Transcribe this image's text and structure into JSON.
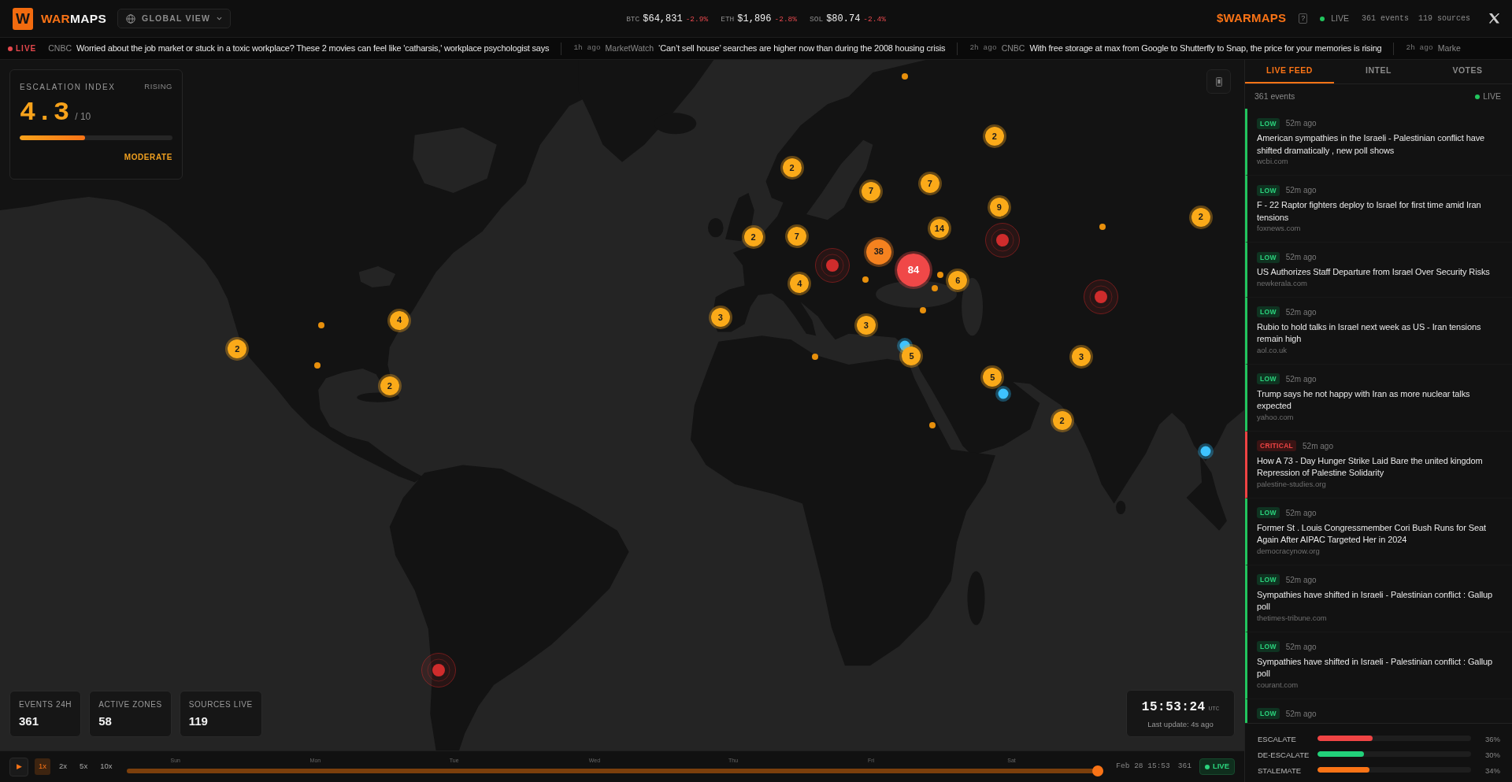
{
  "header": {
    "logo_letter": "W",
    "brand_accent": "WAR",
    "brand_rest": "MAPS",
    "view": "GLOBAL VIEW",
    "prices": [
      {
        "symbol": "BTC",
        "price": "$64,831",
        "change": "-2.9%"
      },
      {
        "symbol": "ETH",
        "price": "$1,896",
        "change": "-2.8%"
      },
      {
        "symbol": "SOL",
        "price": "$80.74",
        "change": "-2.4%"
      }
    ],
    "token": "$WARMAPS",
    "help": "?",
    "status": "LIVE",
    "events": "361 events",
    "sources": "119 sources"
  },
  "ticker": {
    "label": "LIVE",
    "items": [
      {
        "source": "CNBC",
        "headline": "Worried about the job market or stuck in a toxic workplace? These 2 movies can feel like 'catharsis,' workplace psychologist says"
      },
      {
        "time": "1h ago",
        "source": "MarketWatch",
        "headline": "‘Can’t sell house’ searches are higher now than during the 2008 housing crisis"
      },
      {
        "time": "2h ago",
        "source": "CNBC",
        "headline": "With free storage at max from Google to Shutterfly to Snap, the price for your memories is rising"
      },
      {
        "time": "2h ago",
        "source": "Marke"
      }
    ]
  },
  "escalation": {
    "title": "ESCALATION INDEX",
    "trend": "RISING",
    "score": "4.3",
    "scale": "/ 10",
    "level": 0.43,
    "rating": "MODERATE"
  },
  "map": {
    "markers": [
      {
        "kind": "event"
      },
      {
        "kind": "cluster",
        "count": "2"
      },
      {
        "kind": "cluster",
        "count": "2"
      },
      {
        "kind": "cluster",
        "count": "7"
      },
      {
        "kind": "cluster",
        "count": "7"
      },
      {
        "kind": "cluster",
        "count": "9"
      },
      {
        "kind": "cluster",
        "count": "2"
      },
      {
        "kind": "event"
      },
      {
        "kind": "cluster",
        "count": "14"
      },
      {
        "kind": "cluster",
        "count": "7"
      },
      {
        "kind": "cluster",
        "count": "2"
      },
      {
        "kind": "hotspot"
      },
      {
        "kind": "major",
        "count": "38"
      },
      {
        "kind": "hotspot"
      },
      {
        "kind": "critical",
        "count": "84"
      },
      {
        "kind": "event"
      },
      {
        "kind": "event"
      },
      {
        "kind": "cluster",
        "count": "6"
      },
      {
        "kind": "cluster",
        "count": "4"
      },
      {
        "kind": "event"
      },
      {
        "kind": "hotspot"
      },
      {
        "kind": "event"
      },
      {
        "kind": "cluster",
        "count": "3"
      },
      {
        "kind": "cluster",
        "count": "4"
      },
      {
        "kind": "event"
      },
      {
        "kind": "cluster",
        "count": "3"
      },
      {
        "kind": "signal"
      },
      {
        "kind": "cluster",
        "count": "2"
      },
      {
        "kind": "cluster",
        "count": "5"
      },
      {
        "kind": "cluster",
        "count": "3"
      },
      {
        "kind": "event"
      },
      {
        "kind": "event"
      },
      {
        "kind": "cluster",
        "count": "5"
      },
      {
        "kind": "cluster",
        "count": "2"
      },
      {
        "kind": "signal"
      },
      {
        "kind": "cluster",
        "count": "2"
      },
      {
        "kind": "event"
      },
      {
        "kind": "signal"
      },
      {
        "kind": "hotspot"
      }
    ]
  },
  "stats": [
    {
      "label": "EVENTS 24H",
      "value": "361"
    },
    {
      "label": "ACTIVE ZONES",
      "value": "58"
    },
    {
      "label": "SOURCES LIVE",
      "value": "119"
    }
  ],
  "clock": {
    "time": "15:53:24",
    "zone": "UTC",
    "updated": "Last update: 4s ago"
  },
  "timeline": {
    "play": "▶",
    "speeds": [
      {
        "label": "1x",
        "selected": true
      },
      {
        "label": "2x",
        "selected": false
      },
      {
        "label": "5x",
        "selected": false
      },
      {
        "label": "10x",
        "selected": false
      }
    ],
    "days": [
      "Sun",
      "Mon",
      "Tue",
      "Wed",
      "Thu",
      "Fri",
      "Sat"
    ],
    "level": 1,
    "timestamp": "Feb 28 15:53",
    "count": "361",
    "status": "LIVE"
  },
  "sidebar": {
    "tabs": [
      {
        "label": "LIVE FEED",
        "selected": true
      },
      {
        "label": "INTEL",
        "selected": false
      },
      {
        "label": "VOTES",
        "selected": false
      }
    ],
    "count": "361 events",
    "status": "LIVE",
    "feed": [
      {
        "kind": "low",
        "severity": "LOW",
        "time": "52m ago",
        "headline": "American sympathies in the Israeli - Palestinian conflict have shifted dramatically , new poll shows",
        "source": "wcbi.com"
      },
      {
        "kind": "low",
        "severity": "LOW",
        "time": "52m ago",
        "headline": "F - 22 Raptor fighters deploy to Israel for first time amid Iran tensions",
        "source": "foxnews.com"
      },
      {
        "kind": "low",
        "severity": "LOW",
        "time": "52m ago",
        "headline": "US Authorizes Staff Departure from Israel Over Security Risks",
        "source": "newkerala.com"
      },
      {
        "kind": "low",
        "severity": "LOW",
        "time": "52m ago",
        "headline": "Rubio to hold talks in Israel next week as US - Iran tensions remain high",
        "source": "aol.co.uk"
      },
      {
        "kind": "low",
        "severity": "LOW",
        "time": "52m ago",
        "headline": "Trump says he not happy with Iran as more nuclear talks expected",
        "source": "yahoo.com"
      },
      {
        "kind": "critical",
        "severity": "CRITICAL",
        "time": "52m ago",
        "headline": "How A 73 - Day Hunger Strike Laid Bare the united kingdom Repression of Palestine Solidarity",
        "source": "palestine-studies.org"
      },
      {
        "kind": "low",
        "severity": "LOW",
        "time": "52m ago",
        "headline": "Former St . Louis Congressmember Cori Bush Runs for Seat Again After AIPAC Targeted Her in 2024",
        "source": "democracynow.org"
      },
      {
        "kind": "low",
        "severity": "LOW",
        "time": "52m ago",
        "headline": "Sympathies have shifted in Israeli - Palestinian conflict : Gallup poll",
        "source": "thetimes-tribune.com"
      },
      {
        "kind": "low",
        "severity": "LOW",
        "time": "52m ago",
        "headline": "Sympathies have shifted in Israeli - Palestinian conflict : Gallup poll",
        "source": "courant.com"
      },
      {
        "kind": "low",
        "severity": "LOW",
        "time": "52m ago"
      }
    ]
  },
  "votes": [
    {
      "label": "ESCALATE",
      "level": 0.36,
      "percent": "36%",
      "color": "#ef4444"
    },
    {
      "label": "DE-ESCALATE",
      "level": 0.3,
      "percent": "30%",
      "color": "#22d17a"
    },
    {
      "label": "STALEMATE",
      "level": 0.34,
      "percent": "34%",
      "color": "#f97316"
    }
  ]
}
